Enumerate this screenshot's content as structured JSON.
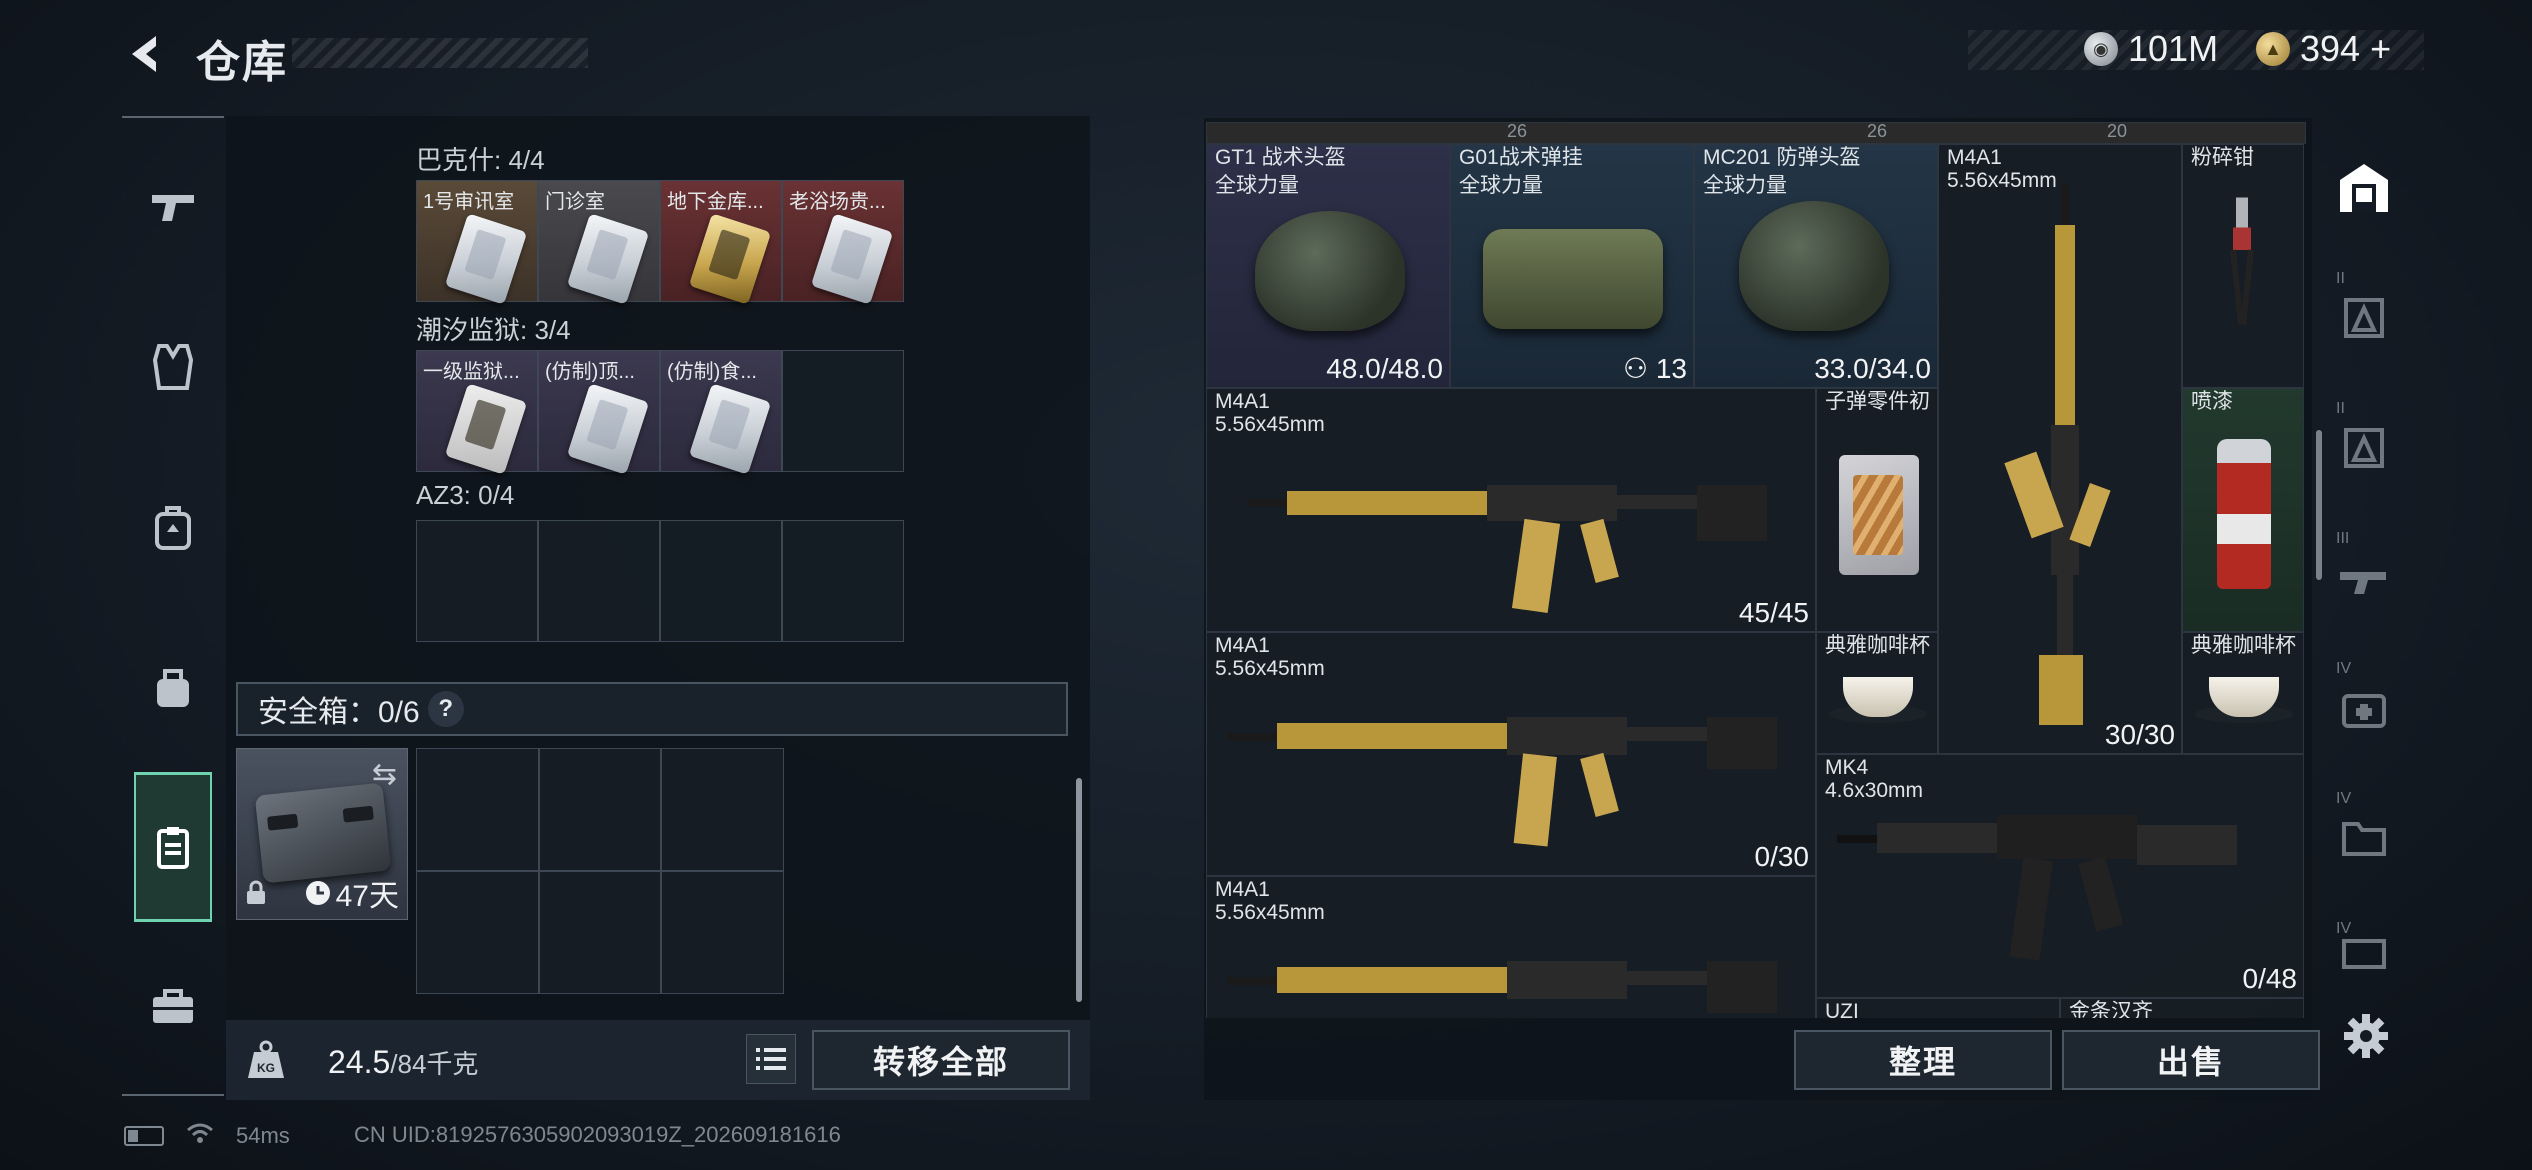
{
  "header": {
    "title": "仓库",
    "currency": [
      {
        "icon": "silver-coin-icon",
        "value": "101M"
      },
      {
        "icon": "gold-coin-icon",
        "value": "394",
        "suffix": "+"
      }
    ]
  },
  "left_nav": [
    {
      "name": "weapons",
      "icon": "gun-icon"
    },
    {
      "name": "armor-vest",
      "icon": "vest-icon"
    },
    {
      "name": "backpack",
      "icon": "backpack-icon"
    },
    {
      "name": "bag",
      "icon": "bag-icon"
    },
    {
      "name": "safebox",
      "icon": "safebox-icon",
      "active": true
    },
    {
      "name": "case",
      "icon": "briefcase-icon"
    }
  ],
  "keycard_sections": [
    {
      "title": "巴克什: 4/4",
      "slots": [
        {
          "label": "1号审讯室",
          "rarity": "orange"
        },
        {
          "label": "门诊室",
          "rarity": "silver"
        },
        {
          "label": "地下金库...",
          "rarity": "red",
          "gold": true
        },
        {
          "label": "老浴场贵...",
          "rarity": "red"
        }
      ]
    },
    {
      "title": "潮汐监狱: 3/4",
      "slots": [
        {
          "label": "一级监狱...",
          "rarity": "purple"
        },
        {
          "label": "(仿制)顶...",
          "rarity": "purple"
        },
        {
          "label": "(仿制)食...",
          "rarity": "purple"
        },
        {
          "label": "",
          "rarity": "empty"
        }
      ]
    },
    {
      "title": "AZ3: 0/4",
      "slots": [
        {
          "label": "",
          "rarity": "empty"
        },
        {
          "label": "",
          "rarity": "empty"
        },
        {
          "label": "",
          "rarity": "empty"
        },
        {
          "label": "",
          "rarity": "empty"
        }
      ]
    }
  ],
  "safebox": {
    "header": "安全箱：0/6",
    "help": "?",
    "time_left": "47天"
  },
  "weight": {
    "current": "24.5",
    "max": "/84千克"
  },
  "buttons": {
    "transfer_all": "转移全部",
    "organize": "整理",
    "sell": "出售"
  },
  "stash_items": [
    {
      "name": "GT1 战术头盔",
      "sub": "全球力量",
      "value": "48.0/48.0",
      "top_badge": "26"
    },
    {
      "name": "G01战术弹挂",
      "sub": "全球力量",
      "value": "13",
      "value_icon": "vest-icon"
    },
    {
      "name": "MC201 防弹头盔",
      "sub": "全球力量",
      "value": "33.0/34.0",
      "top_badge": "26"
    },
    {
      "name": "M4A1",
      "sub": "5.56x45mm",
      "value": "30/30",
      "top_badge": "20"
    },
    {
      "name": "粉碎钳",
      "sub": "",
      "value": ""
    },
    {
      "name": "M4A1",
      "sub": "5.56x45mm",
      "value": "45/45"
    },
    {
      "name": "子弹零件初",
      "sub": "",
      "value": ""
    },
    {
      "name": "喷漆",
      "sub": "",
      "value": ""
    },
    {
      "name": "M4A1",
      "sub": "5.56x45mm",
      "value": "0/30"
    },
    {
      "name": "典雅咖啡杯",
      "sub": "",
      "value": ""
    },
    {
      "name": "典雅咖啡杯",
      "sub": "",
      "value": ""
    },
    {
      "name": "MK4",
      "sub": "4.6x30mm",
      "value": "0/48"
    },
    {
      "name": "M4A1",
      "sub": "5.56x45mm",
      "value": ""
    },
    {
      "name": "UZI",
      "sub": "",
      "value": ""
    },
    {
      "name": "金条汉齐",
      "sub": "",
      "value": ""
    }
  ],
  "category_nav": [
    {
      "name": "all",
      "icon": "home-icon",
      "active": true
    },
    {
      "name": "tier-2-armor",
      "icon": "armor-icon",
      "roman": "II"
    },
    {
      "name": "tier-2-armor-alt",
      "icon": "armor-icon",
      "roman": "II"
    },
    {
      "name": "tier-3",
      "icon": "weapon-icon",
      "roman": "III"
    },
    {
      "name": "tier-4-medical",
      "icon": "medkit-icon",
      "roman": "IV"
    },
    {
      "name": "tier-4-folder",
      "icon": "folder-icon",
      "roman": "IV"
    },
    {
      "name": "tier-4-extra",
      "icon": "box-icon",
      "roman": "IV"
    }
  ],
  "status": {
    "ping": "54ms",
    "uid": "CN UID:8192576305902093019Z_202609181616"
  }
}
